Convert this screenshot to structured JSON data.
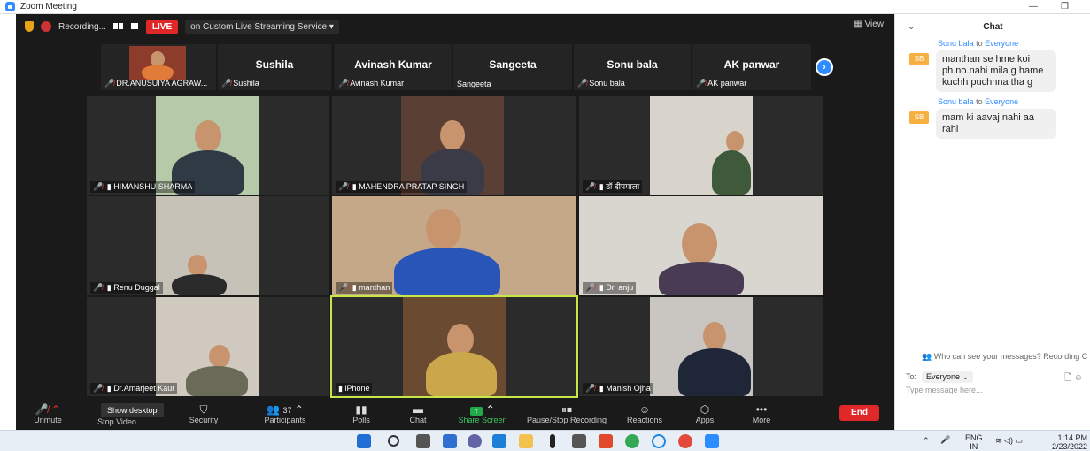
{
  "window": {
    "title": "Zoom Meeting"
  },
  "topbar": {
    "recording_label": "Recording...",
    "live_label": "LIVE",
    "stream_label": "on Custom Live Streaming Service ▾",
    "view_label": "View"
  },
  "strip": [
    {
      "name": "",
      "label": "DR.ANUSUIYA AGRAW..."
    },
    {
      "name": "Sushila",
      "label": "Sushila"
    },
    {
      "name": "Avinash Kumar",
      "label": "Avinash Kumar"
    },
    {
      "name": "Sangeeta",
      "label": "Sangeeta"
    },
    {
      "name": "Sonu bala",
      "label": "Sonu bala"
    },
    {
      "name": "AK panwar",
      "label": "AK panwar"
    }
  ],
  "tiles": [
    {
      "label": "HIMANSHU SHARMA"
    },
    {
      "label": "MAHENDRA PRATAP SINGH"
    },
    {
      "label": "डॉ दीपमाला"
    },
    {
      "label": "Renu Duggal"
    },
    {
      "label": "manthan"
    },
    {
      "label": "Dr. anju"
    },
    {
      "label": "Dr.Amarjeet Kaur"
    },
    {
      "label": "iPhone"
    },
    {
      "label": "Manish Ojha"
    }
  ],
  "toolbar": {
    "unmute": "Unmute",
    "stop_video": "Stop Video",
    "show_desktop": "Show desktop",
    "security": "Security",
    "participants": "Participants",
    "participants_count": "37",
    "polls": "Polls",
    "chat": "Chat",
    "share": "Share Screen",
    "pause_rec": "Pause/Stop Recording",
    "reactions": "Reactions",
    "apps": "Apps",
    "more": "More",
    "end": "End"
  },
  "chat": {
    "title": "Chat",
    "messages": [
      {
        "from": "Sonu bala",
        "to": "Everyone",
        "initials": "SB",
        "text": "manthan se hme koi ph.no.nahi mila g hame kuchh puchhna tha g"
      },
      {
        "from": "Sonu bala",
        "to": "Everyone",
        "initials": "SB",
        "text": "mam ki aavaj nahi aa rahi"
      }
    ],
    "privacy": "Who can see your messages? Recording C",
    "to_label": "To:",
    "to_value": "Everyone ⌄",
    "placeholder": "Type message here..."
  },
  "tray": {
    "lang1": "ENG",
    "lang2": "IN",
    "time": "1:14 PM",
    "date": "2/23/2022"
  },
  "colors": {
    "accent": "#2d8cff",
    "live": "#e02828",
    "speaker_border": "#c7e64a"
  }
}
